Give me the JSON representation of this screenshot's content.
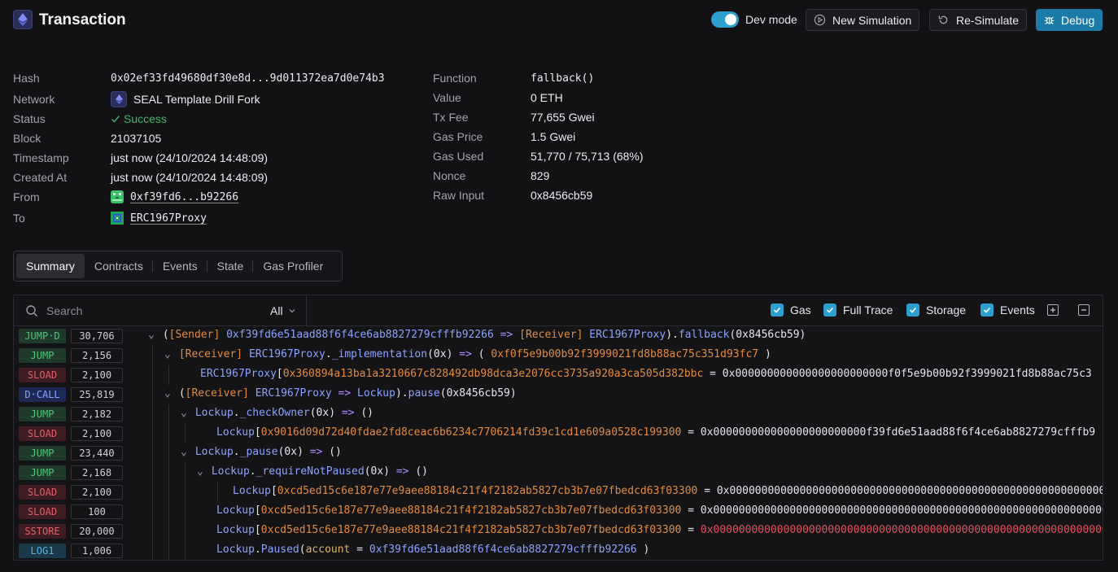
{
  "header": {
    "title": "Transaction",
    "dev_mode_label": "Dev mode",
    "dev_mode_on": true,
    "buttons": {
      "new_simulation": "New Simulation",
      "re_simulate": "Re-Simulate",
      "debug": "Debug"
    },
    "accent": "#2c9fcf"
  },
  "details": {
    "left": [
      {
        "label": "Hash",
        "value": "0x02ef33fd49680df30e8d...9d011372ea7d0e74b3"
      },
      {
        "label": "Network",
        "value": "SEAL Template Drill Fork"
      },
      {
        "label": "Status",
        "value": "Success"
      },
      {
        "label": "Block",
        "value": "21037105"
      },
      {
        "label": "Timestamp",
        "value": "just now (24/10/2024 14:48:09)"
      },
      {
        "label": "Created At",
        "value": "just now (24/10/2024 14:48:09)"
      },
      {
        "label": "From",
        "value": "0xf39fd6...b92266"
      },
      {
        "label": "To",
        "value": "ERC1967Proxy"
      }
    ],
    "right": [
      {
        "label": "Function",
        "value": "fallback()"
      },
      {
        "label": "Value",
        "value": "0 ETH"
      },
      {
        "label": "Tx Fee",
        "value": "77,655 Gwei"
      },
      {
        "label": "Gas Price",
        "value": "1.5 Gwei"
      },
      {
        "label": "Gas Used",
        "value": "51,770 / 75,713 (68%)"
      },
      {
        "label": "Nonce",
        "value": "829"
      },
      {
        "label": "Raw Input",
        "value": "0x8456cb59"
      }
    ]
  },
  "tabs": [
    "Summary",
    "Contracts",
    "Events",
    "State",
    "Gas Profiler"
  ],
  "active_tab": "Summary",
  "trace": {
    "search_placeholder": "Search",
    "filter_value": "All",
    "toggles": [
      "Gas",
      "Full Trace",
      "Storage",
      "Events"
    ],
    "rows": [
      {
        "op": "JUMP·D",
        "gas": "30,706"
      },
      {
        "op": "JUMP",
        "gas": "2,156"
      },
      {
        "op": "SLOAD",
        "gas": "2,100"
      },
      {
        "op": "D·CALL",
        "gas": "25,819"
      },
      {
        "op": "JUMP",
        "gas": "2,182"
      },
      {
        "op": "SLOAD",
        "gas": "2,100"
      },
      {
        "op": "JUMP",
        "gas": "23,440"
      },
      {
        "op": "JUMP",
        "gas": "2,168"
      },
      {
        "op": "SLOAD",
        "gas": "2,100"
      },
      {
        "op": "SLOAD",
        "gas": "100"
      },
      {
        "op": "SSTORE",
        "gas": "20,000"
      },
      {
        "op": "LOG1",
        "gas": "1,006"
      }
    ],
    "text": {
      "sender": "[Sender]",
      "receiver": "[Receiver]",
      "sender_addr": "0xf39fd6e51aad88f6f4ce6ab8827279cfffb92266",
      "arrow": "=>",
      "proxy": "ERC1967Proxy",
      "fallback": "fallback",
      "input": "(0x8456cb59)",
      "impl_fn": "_implementation",
      "zero_args": "(0x)",
      "impl_result": "0xf0f5e9b00b92f3999021fd8b88ac75c351d93fc7",
      "slot_impl": "0x360894a13ba1a3210667c828492db98dca3e2076cc3735a920a3ca505d382bbc",
      "val_impl": "0x000000000000000000000000f0f5e9b00b92f3999021fd8b88ac75c3",
      "lockup": "Lockup",
      "pause": "pause",
      "check_owner": "_checkOwner",
      "empty_ret": "()",
      "slot_owner": "0x9016d09d72d40fdae2fd8ceac6b6234c7706214fd39c1cd1e609a0528c199300",
      "val_owner": "0x000000000000000000000000f39fd6e51aad88f6f4ce6ab8827279cfffb9",
      "pause_internal": "_pause",
      "require_not_paused": "_requireNotPaused",
      "slot_paused": "0xcd5ed15c6e187e77e9aee88184c21f4f2182ab5827cb3b7e07fbedcd63f03300",
      "val_paused": "0x00000000000000000000000000000000000000000000000000000000000000000",
      "val_paused_short": "0x0000000000000000000000000000000000000000000000000000000000000000",
      "paused_event": "Paused",
      "account_kw": "account",
      "eq": "="
    }
  }
}
